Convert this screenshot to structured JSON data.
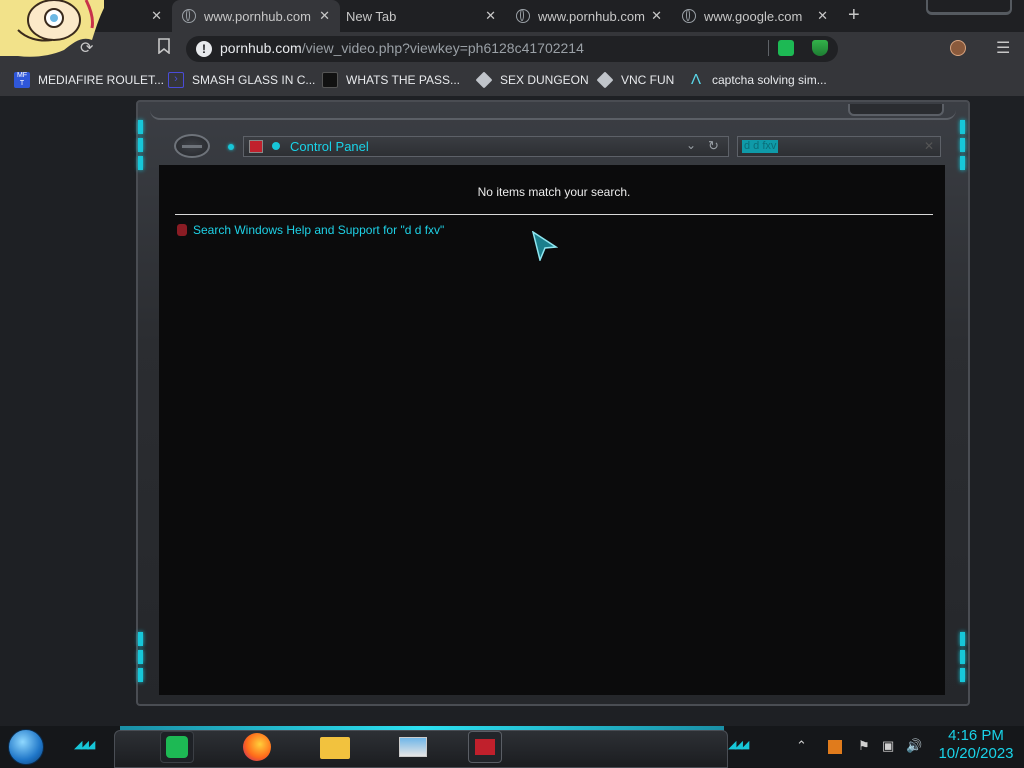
{
  "browser": {
    "tabs": [
      {
        "title": "",
        "active": false
      },
      {
        "title": "www.pornhub.com",
        "active": true
      },
      {
        "title": "New Tab",
        "active": false
      },
      {
        "title": "www.pornhub.com",
        "active": false
      },
      {
        "title": "www.google.com",
        "active": false
      }
    ],
    "omnibox": {
      "domain": "pornhub.com",
      "path": "/view_video.php?viewkey=ph6128c41702214"
    },
    "bookmarks": [
      {
        "label": "MEDIAFIRE ROULET...",
        "icon": "mediafire-icon",
        "color": "#2f57d9"
      },
      {
        "label": "SMASH GLASS IN C...",
        "icon": "chevron-icon",
        "color": "#4a4cd8"
      },
      {
        "label": "WHATS THE PASS...",
        "icon": "terminal-icon",
        "color": "#202124"
      },
      {
        "label": "SEX DUNGEON",
        "icon": "cube-icon",
        "color": "#c0c4ca"
      },
      {
        "label": "VNC FUN",
        "icon": "cube-icon",
        "color": "#c0c4ca"
      },
      {
        "label": "captcha solving sim...",
        "icon": "lambda-icon",
        "color": "#5ad6e8"
      }
    ]
  },
  "explorer": {
    "location": "Control Panel",
    "search_query": "d d fxv",
    "no_results": "No items match your search.",
    "help_link": "Search Windows Help and Support for \"d d fxv\""
  },
  "taskbar": {
    "time": "4:16 PM",
    "date": "10/20/2023",
    "pinned": [
      "spotify-icon",
      "firefox-icon",
      "file-explorer-icon",
      "photos-icon",
      "control-panel-icon"
    ]
  },
  "colors": {
    "accent": "#19d3e8",
    "frame": "#2b2d31",
    "content_bg": "#0b0b0c"
  }
}
